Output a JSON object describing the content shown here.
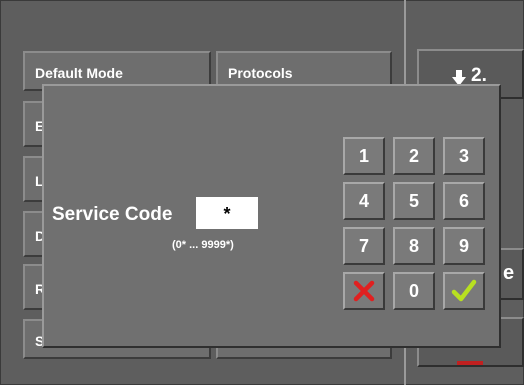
{
  "background": {
    "tiles": [
      {
        "label": "Default Mode"
      },
      {
        "label": "Protocols"
      },
      {
        "label": "E"
      },
      {
        "label": "L"
      },
      {
        "label": "D"
      },
      {
        "label": "R"
      },
      {
        "label": "S"
      }
    ],
    "side_top_button": {
      "icon": "arrow-down-icon",
      "label": "2."
    },
    "side_mid_button_fragment": "e"
  },
  "dialog": {
    "label": "Service Code",
    "value": "*",
    "range_hint": "(0* ... 9999*)"
  },
  "keypad": {
    "keys": [
      "1",
      "2",
      "3",
      "4",
      "5",
      "6",
      "7",
      "8",
      "9",
      "",
      "0",
      ""
    ],
    "cancel_icon": "cross-icon",
    "confirm_icon": "check-icon",
    "colors": {
      "cancel": "#e02020",
      "confirm": "#b8e020"
    }
  }
}
